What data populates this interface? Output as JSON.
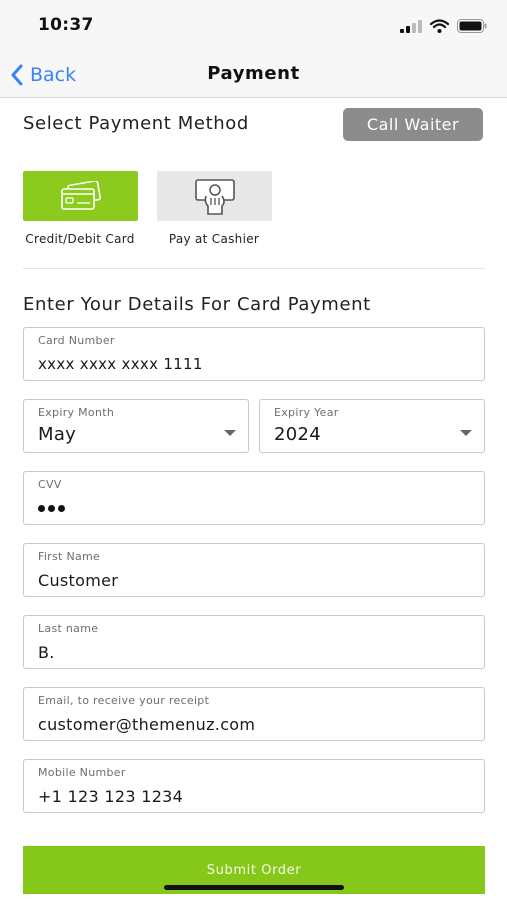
{
  "status": {
    "time": "10:37"
  },
  "nav": {
    "back_label": "Back",
    "title": "Payment"
  },
  "payment_method": {
    "heading": "Select Payment Method",
    "call_waiter_label": "Call Waiter",
    "options": [
      {
        "label": "Credit/Debit Card",
        "icon": "credit-card-icon",
        "selected": true
      },
      {
        "label": "Pay at Cashier",
        "icon": "cash-payment-icon",
        "selected": false
      }
    ]
  },
  "card_form": {
    "heading": "Enter Your Details For Card Payment",
    "card_number": {
      "label": "Card Number",
      "value": "xxxx xxxx xxxx 1111"
    },
    "expiry_month": {
      "label": "Expiry Month",
      "value": "May"
    },
    "expiry_year": {
      "label": "Expiry Year",
      "value": "2024"
    },
    "cvv": {
      "label": "CVV",
      "masked_length": 3
    },
    "first_name": {
      "label": "First Name",
      "value": "Customer"
    },
    "last_name": {
      "label": "Last name",
      "value": "B."
    },
    "email": {
      "label": "Email, to receive your receipt",
      "value": "customer@themenuz.com"
    },
    "mobile": {
      "label": "Mobile Number",
      "value": "+1 123 123 1234"
    }
  },
  "submit": {
    "label": "Submit Order"
  },
  "colors": {
    "accent_green": "#8ccb1e",
    "link_blue": "#3b82f6",
    "call_waiter_gray": "#8c8c8c"
  }
}
